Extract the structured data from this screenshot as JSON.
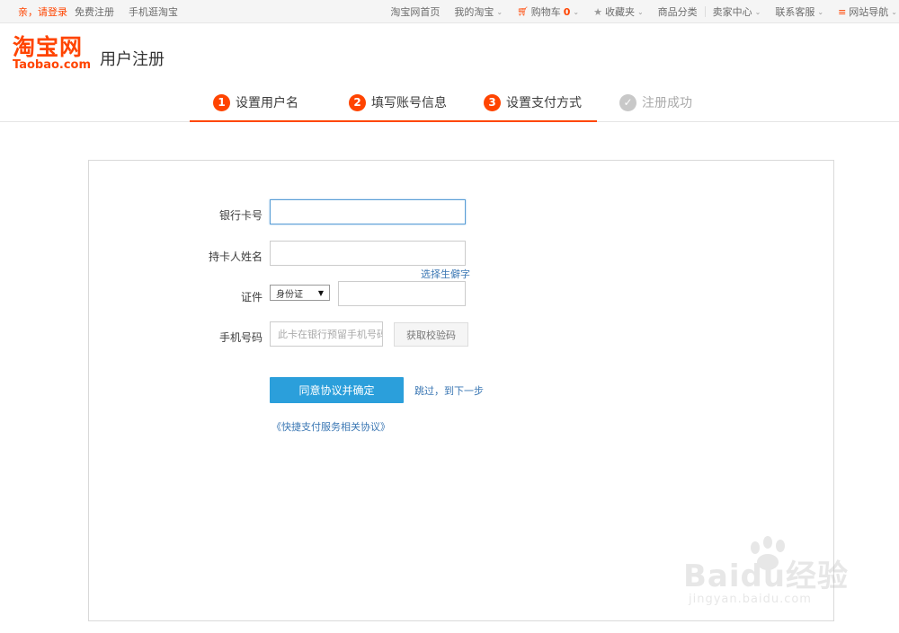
{
  "topbar": {
    "login_greeting": "亲，请登录",
    "register": "免费注册",
    "mobile": "手机逛淘宝",
    "home": "淘宝网首页",
    "my_taobao": "我的淘宝",
    "cart_label": "购物车",
    "cart_count": "0",
    "favorites": "收藏夹",
    "categories": "商品分类",
    "seller_center": "卖家中心",
    "customer_service": "联系客服",
    "site_nav": "网站导航"
  },
  "header": {
    "logo_cn": "淘宝网",
    "logo_en": "Taobao.com",
    "page_title": "用户注册"
  },
  "steps": [
    {
      "num": "1",
      "label": "设置用户名"
    },
    {
      "num": "2",
      "label": "填写账号信息"
    },
    {
      "num": "3",
      "label": "设置支付方式"
    },
    {
      "num": "",
      "label": "注册成功"
    }
  ],
  "form": {
    "card_number_label": "银行卡号",
    "card_number_value": "",
    "holder_name_label": "持卡人姓名",
    "holder_name_value": "",
    "rare_char_link": "选择生僻字",
    "id_label": "证件",
    "id_type_selected": "身份证",
    "id_number_value": "",
    "phone_label": "手机号码",
    "phone_placeholder": "此卡在银行预留手机号码",
    "get_code_button": "获取校验码",
    "submit_button": "同意协议并确定",
    "skip_link": "跳过，到下一步",
    "agreement_link": "《快捷支付服务相关协议》"
  },
  "watermark": {
    "brand": "Baidu经验",
    "url": "jingyan.baidu.com"
  },
  "colors": {
    "accent": "#ff4400",
    "primary_button": "#2b9fdb",
    "link": "#3c78b4"
  }
}
